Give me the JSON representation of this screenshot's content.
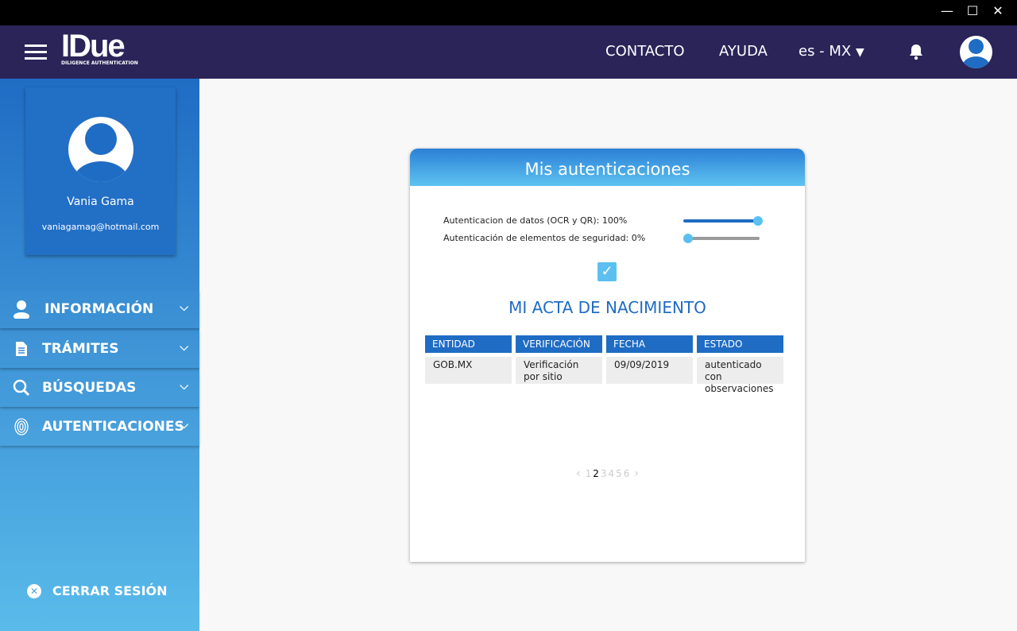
{
  "window": {
    "minimize": "—",
    "maximize": "☐",
    "close": "✕"
  },
  "header": {
    "logo": "IDue",
    "logo_sub": "DILIGENCE AUTHENTICATION",
    "nav": [
      "CONTACTO",
      "AYUDA"
    ],
    "language": "es - MX"
  },
  "profile": {
    "name": "Vania Gama",
    "email": "vaniagamag@hotmail.com"
  },
  "sidebar": {
    "items": [
      {
        "label": "INFORMACIÓN"
      },
      {
        "label": "TRÁMITES"
      },
      {
        "label": "BÚSQUEDAS"
      },
      {
        "label": "AUTENTICACIONES"
      }
    ],
    "logout": "CERRAR SESIÓN"
  },
  "card": {
    "title": "Mis autenticaciones",
    "progress": [
      {
        "label": "Autenticacion de datos (OCR y QR): 100%",
        "value": 100
      },
      {
        "label": "Autenticación de elementos de seguridad: 0%",
        "value": 0
      }
    ],
    "document_title": "MI ACTA DE NACIMIENTO",
    "table": {
      "headers": [
        "ENTIDAD",
        "VERIFICACIÓN",
        "FECHA",
        "ESTADO"
      ],
      "rows": [
        [
          "GOB.MX",
          "Verificación por sitio",
          "09/09/2019",
          "autenticado con observaciones"
        ]
      ]
    },
    "pagination": {
      "pages": [
        "1",
        "2",
        "3",
        "4",
        "5",
        "6"
      ],
      "current": "2"
    }
  }
}
